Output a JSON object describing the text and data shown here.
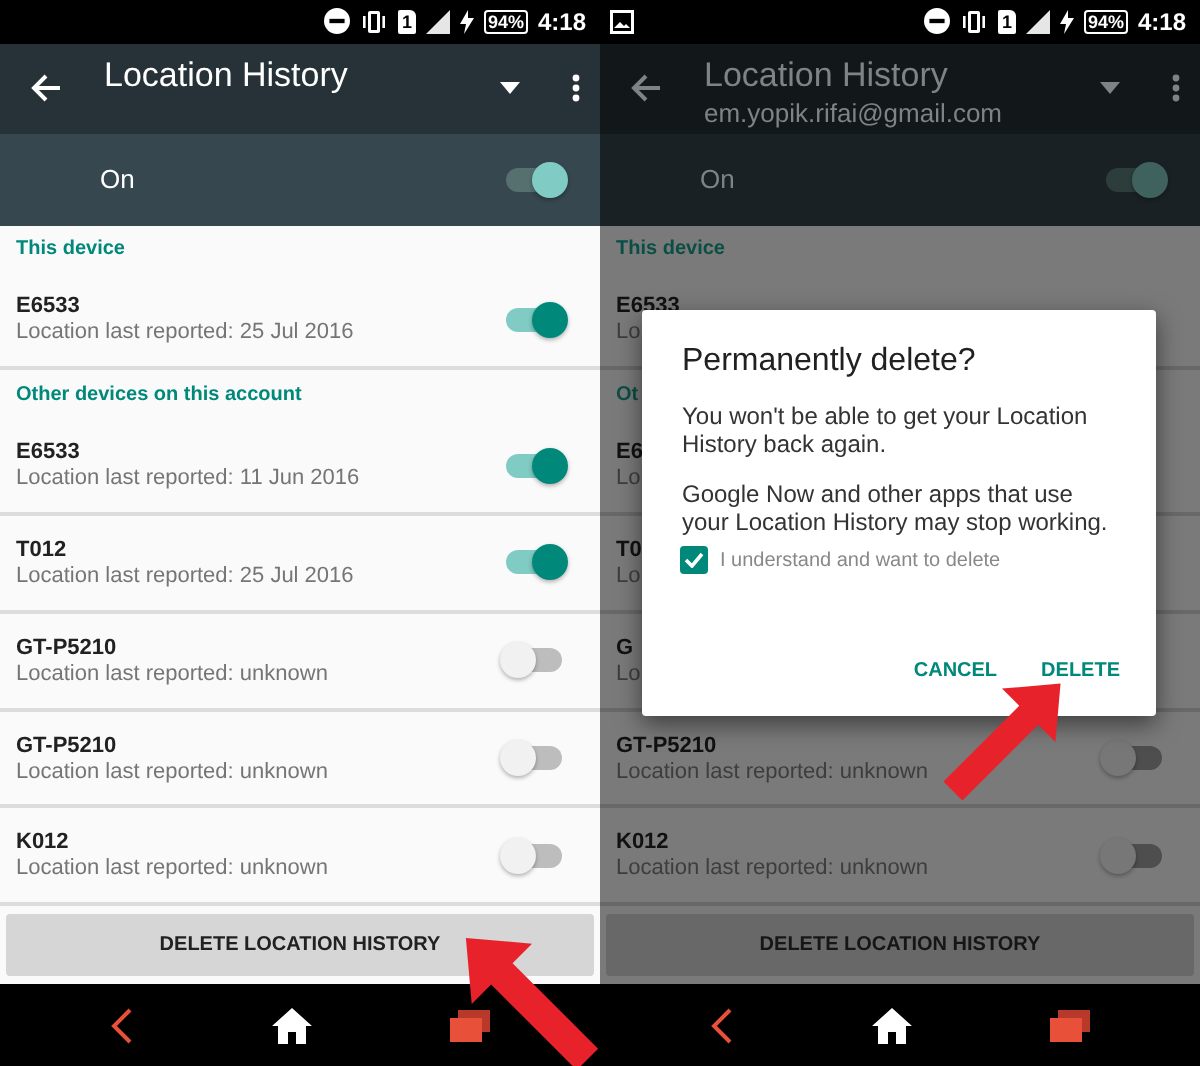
{
  "screens": [
    {
      "dimmed": false,
      "status_bar": {
        "notification_icon": false,
        "sim_label": "1",
        "battery": "94%",
        "time": "4:18"
      },
      "app_bar": {
        "title": "Location History"
      },
      "master_switch": {
        "label": "On",
        "on": true
      },
      "sections": [
        {
          "header": "This device",
          "devices": [
            {
              "name": "E6533",
              "detail": "Location last reported: 25 Jul 2016",
              "on": true
            }
          ]
        },
        {
          "header": "Other devices on this account",
          "devices": [
            {
              "name": "E6533",
              "detail": "Location last reported: 11 Jun 2016",
              "on": true
            },
            {
              "name": "T012",
              "detail": "Location last reported: 25 Jul 2016",
              "on": true
            },
            {
              "name": "GT-P5210",
              "detail": "Location last reported: unknown",
              "on": false
            },
            {
              "name": "GT-P5210",
              "detail": "Location last reported: unknown",
              "on": false
            },
            {
              "name": "K012",
              "detail": "Location last reported: unknown",
              "on": false
            }
          ]
        }
      ],
      "delete_button": "DELETE LOCATION HISTORY",
      "arrow": {
        "kind": "up-left"
      }
    },
    {
      "dimmed": true,
      "status_bar": {
        "notification_icon": true,
        "sim_label": "1",
        "battery": "94%",
        "time": "4:18"
      },
      "app_bar": {
        "title": "Location History",
        "subtitle": "em.yopik.rifai@gmail.com"
      },
      "master_switch": {
        "label": "On",
        "on": true
      },
      "sections": [
        {
          "header": "This device",
          "devices": [
            {
              "name": "E6533",
              "detail": "Lo"
            }
          ]
        },
        {
          "header": "Ot",
          "devices": [
            {
              "name": "E6",
              "detail": "Lo"
            },
            {
              "name": "T0",
              "detail": "Lo"
            },
            {
              "name": "G",
              "detail": "Lo"
            },
            {
              "name": "GT-P5210",
              "detail": "Location last reported: unknown",
              "on": false
            },
            {
              "name": "K012",
              "detail": "Location last reported: unknown",
              "on": false
            }
          ]
        }
      ],
      "delete_button": "DELETE LOCATION HISTORY",
      "dialog": {
        "title": "Permanently delete?",
        "paragraphs": [
          "You won't be able to get your Location History back again.",
          "Google Now and other apps that use your Location History may stop working."
        ],
        "checkbox": {
          "label": "I understand and want to delete",
          "checked": true
        },
        "buttons": [
          "CANCEL",
          "DELETE"
        ]
      },
      "arrow": {
        "kind": "up-right"
      }
    }
  ]
}
